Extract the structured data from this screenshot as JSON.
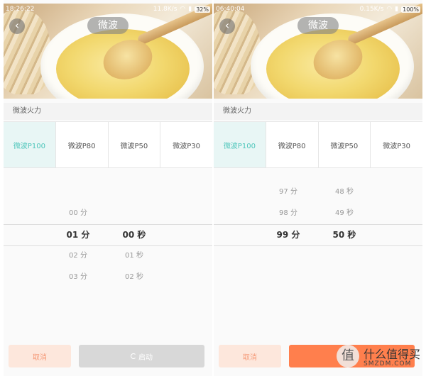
{
  "screens": [
    {
      "status": {
        "time": "18:26:22",
        "speed": "11.8K/s",
        "battery": "32%"
      },
      "title": "微波",
      "back_icon": "chevron-left-icon",
      "section_label": "微波火力",
      "tabs": [
        {
          "label": "微波P100",
          "active": true
        },
        {
          "label": "微波P80",
          "active": false
        },
        {
          "label": "微波P50",
          "active": false
        },
        {
          "label": "微波P30",
          "active": false
        }
      ],
      "picker": {
        "minutes": [
          "",
          "00 分",
          "01 分",
          "02 分",
          "03 分"
        ],
        "seconds": [
          "",
          "",
          "00 秒",
          "01 秒",
          "02 秒"
        ],
        "selected_index": 2
      },
      "cancel_label": "取消",
      "start_label": "启动",
      "start_enabled": false
    },
    {
      "status": {
        "time": "06:40:04",
        "speed": "0.15K/s",
        "battery": "100%"
      },
      "title": "微波",
      "back_icon": "chevron-left-icon",
      "section_label": "微波火力",
      "tabs": [
        {
          "label": "微波P100",
          "active": true
        },
        {
          "label": "微波P80",
          "active": false
        },
        {
          "label": "微波P50",
          "active": false
        },
        {
          "label": "微波P30",
          "active": false
        }
      ],
      "picker": {
        "minutes": [
          "97 分",
          "98 分",
          "99 分",
          "",
          ""
        ],
        "seconds": [
          "48 秒",
          "49 秒",
          "50 秒",
          "",
          ""
        ],
        "selected_index": 2
      },
      "cancel_label": "取消",
      "start_label": "",
      "start_enabled": true
    }
  ],
  "watermark": {
    "title": "什么值得买",
    "sub": "SMZDM.COM",
    "mark": "值"
  },
  "colors": {
    "accent_teal": "#4fc6bb",
    "orange": "#ff7f4d",
    "cancel_bg": "#fde7dc"
  }
}
